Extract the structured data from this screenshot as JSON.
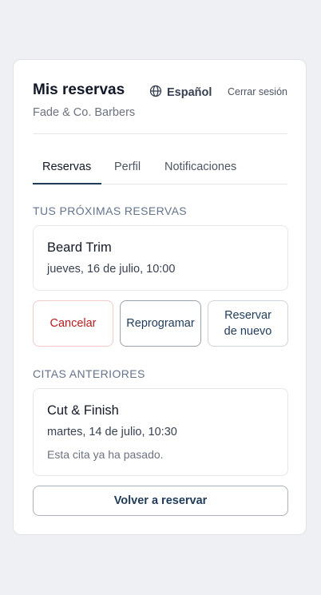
{
  "header": {
    "title": "Mis reservas",
    "shop": "Fade & Co. Barbers",
    "language": "Español",
    "logout": "Cerrar sesión"
  },
  "tabs": [
    {
      "label": "Reservas",
      "active": true
    },
    {
      "label": "Perfil",
      "active": false
    },
    {
      "label": "Notificaciones",
      "active": false
    }
  ],
  "upcoming": {
    "heading": "TUS PRÓXIMAS RESERVAS",
    "item": {
      "service": "Beard Trim",
      "datetime": "jueves, 16 de julio, 10:00"
    },
    "actions": {
      "cancel": "Cancelar",
      "reschedule": "Reprogramar",
      "rebook_line1": "Reservar",
      "rebook_line2": "de nuevo"
    }
  },
  "past": {
    "heading": "CITAS ANTERIORES",
    "item": {
      "service": "Cut & Finish",
      "datetime": "martes, 14 de julio, 10:30",
      "note": "Esta cita ya ha pasado."
    },
    "rebook": "Volver a reservar"
  },
  "colors": {
    "accent": "#1f3b5a",
    "danger": "#b91c1c",
    "background": "#eef0f3"
  }
}
